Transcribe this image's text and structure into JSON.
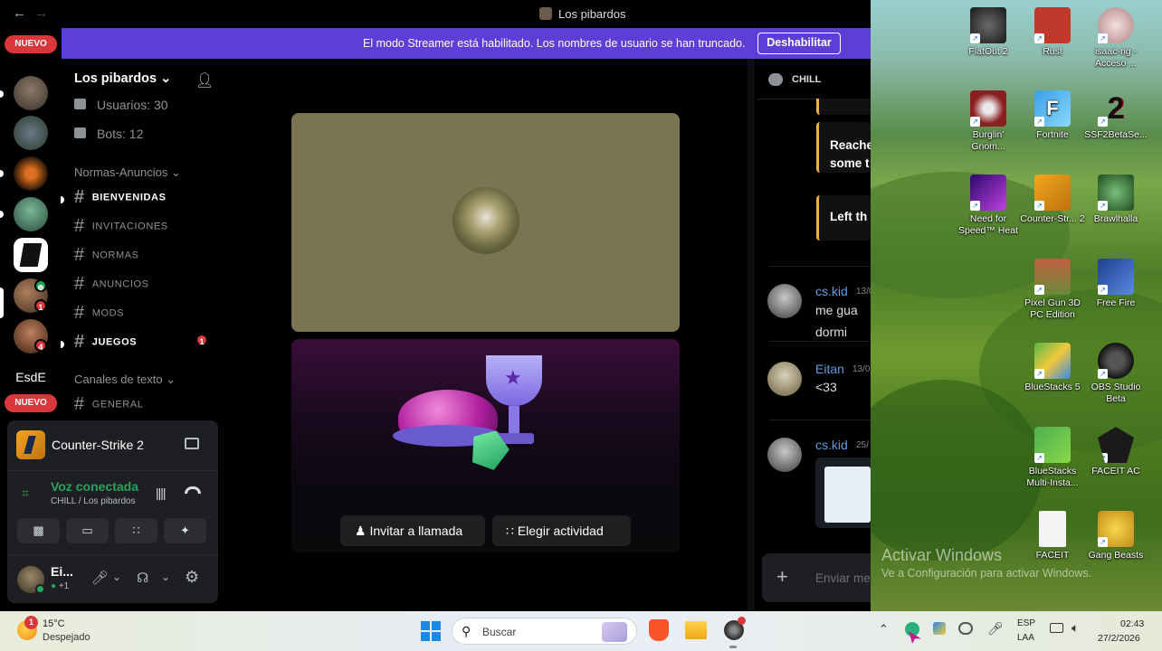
{
  "window": {
    "title": "Los pibardos"
  },
  "banner": {
    "message": "El modo Streamer está habilitado. Los nombres de usuario se han truncado.",
    "button": "Deshabilitar"
  },
  "servers": {
    "new_badge": "NUEVO",
    "new_badge_2": "NUEVO",
    "text_server": "EsdE",
    "badges": [
      "1",
      "4"
    ]
  },
  "server_header": {
    "name": "Los pibardos"
  },
  "stats": {
    "users": "Usuarios: 30",
    "bots": "Bots: 12"
  },
  "categories": {
    "rules": "Normas-Anuncios",
    "text": "Canales de texto"
  },
  "channels": [
    {
      "name": "BIENVENIDAS",
      "unread": true
    },
    {
      "name": "INVITACIONES",
      "unread": false
    },
    {
      "name": "NORMAS",
      "unread": false
    },
    {
      "name": "ANUNCIOS",
      "unread": false
    },
    {
      "name": "MODS",
      "unread": false
    },
    {
      "name": "JUEGOS",
      "unread": true,
      "badge": "1"
    },
    {
      "name": "GENERAL",
      "unread": false
    }
  ],
  "activity": {
    "game": "Counter-Strike 2"
  },
  "voice": {
    "status": "Voz conectada",
    "location": "CHILL / Los pibardos"
  },
  "user": {
    "name": "Ei...",
    "sub": "+1"
  },
  "stage": {
    "invite_button": "Invitar a llamada",
    "activity_button": "Elegir actividad"
  },
  "chat": {
    "channel": "CHILL",
    "embeds": [
      "Reache",
      "some t",
      "Left th"
    ],
    "messages": [
      {
        "author": "cs.kid",
        "time": "13/0",
        "lines": [
          "me gua",
          "dormi"
        ]
      },
      {
        "author": "Eitan",
        "time": "13/0",
        "lines": [
          "<33"
        ]
      },
      {
        "author": "cs.kid",
        "time": "25/",
        "lines": []
      }
    ],
    "input_placeholder": "Enviar me"
  },
  "desktop_icons": [
    {
      "label": "FlatOut 2",
      "color": "#2a2a2a"
    },
    {
      "label": "Rust",
      "color": "#c0392b"
    },
    {
      "label": "isaac-ng - Acceso ...",
      "color": "#e8c8c8"
    },
    {
      "label": "Burglin' Gnom...",
      "color": "#8b1e1e"
    },
    {
      "label": "Fortnite",
      "color": "#3aa0e8"
    },
    {
      "label": "SSF2BetaSe...",
      "color": "#111"
    },
    {
      "label": "Need for Speed™ Heat",
      "color": "#3a1a7a"
    },
    {
      "label": "Counter-Str... 2",
      "color": "#f2a71b"
    },
    {
      "label": "Brawlhalla",
      "color": "#2e6b2e"
    },
    {
      "label": "Pixel Gun 3D PC Edition",
      "color": "#6a8a3a"
    },
    {
      "label": "Free Fire",
      "color": "#1e3f8a"
    },
    {
      "label": "BlueStacks 5",
      "color": "#56b847"
    },
    {
      "label": "OBS Studio Beta",
      "color": "#222"
    },
    {
      "label": "BlueStacks Multi-Insta...",
      "color": "#4caf50"
    },
    {
      "label": "FACEIT AC",
      "color": "#ff5500"
    },
    {
      "label": "FACEIT",
      "color": "#f4f4f4"
    },
    {
      "label": "Gang Beasts",
      "color": "#e8c23a"
    }
  ],
  "watermark": {
    "title": "Activar Windows",
    "sub": "Ve a Configuración para activar Windows."
  },
  "taskbar": {
    "weather_temp": "15°C",
    "weather_desc": "Despejado",
    "weather_badge": "1",
    "search_placeholder": "Buscar",
    "lang_top": "ESP",
    "lang_bottom": "LAA",
    "time": "02:43",
    "date": "27/2/2026"
  }
}
